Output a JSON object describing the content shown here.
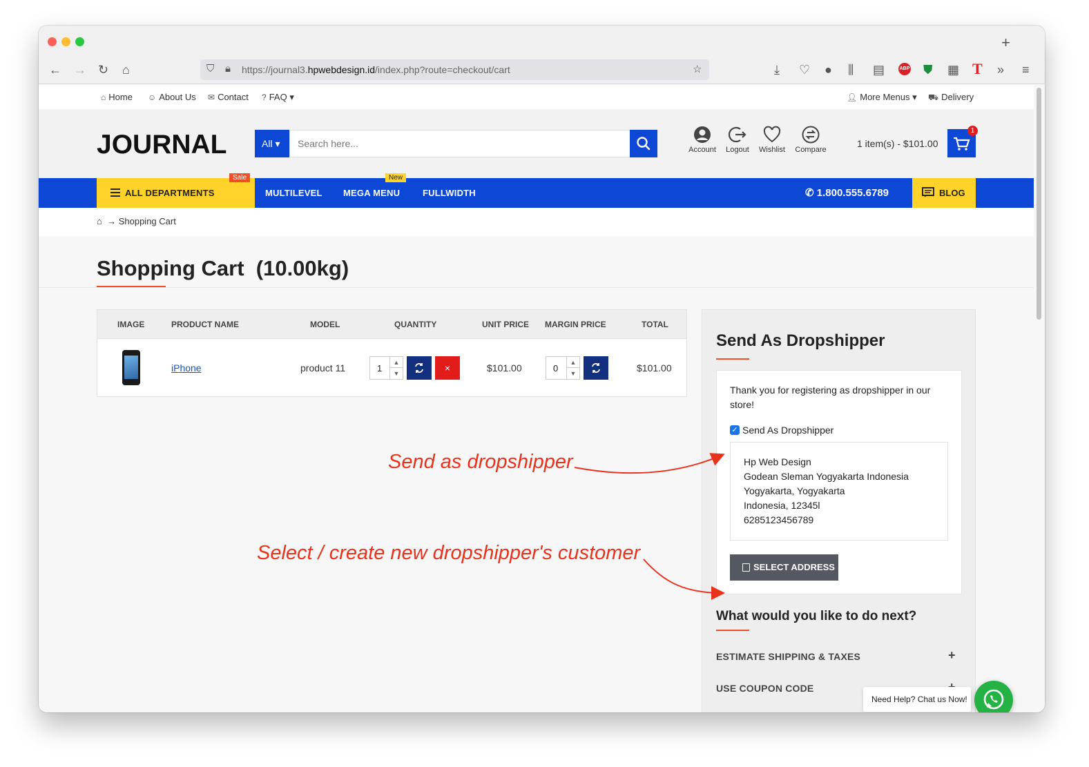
{
  "browser": {
    "url_prefix": "https://journal3.",
    "url_domain": "hpwebdesign.id",
    "url_path": "/index.php?route=checkout/cart",
    "abp_label": "ABP",
    "ext_t_label": "T"
  },
  "topbar": {
    "links": [
      "Home",
      "About Us",
      "Contact",
      "FAQ"
    ],
    "right_links": [
      "More Menus",
      "Delivery"
    ]
  },
  "header": {
    "logo": "JOURNAL",
    "search_category": "All",
    "search_placeholder": "Search here...",
    "icons": [
      "Account",
      "Logout",
      "Wishlist",
      "Compare"
    ],
    "cart_summary": "1 item(s) - $101.00",
    "cart_count": "1"
  },
  "nav": {
    "departments": "ALL DEPARTMENTS",
    "sale_badge": "Sale",
    "new_badge": "New",
    "links": [
      "MULTILEVEL",
      "MEGA MENU",
      "FULLWIDTH"
    ],
    "phone": "1.800.555.6789",
    "blog": "BLOG"
  },
  "breadcrumb": {
    "arrow": "→",
    "current": "Shopping Cart"
  },
  "page": {
    "title": "Shopping Cart  (10.00kg)"
  },
  "cart": {
    "columns": [
      "IMAGE",
      "PRODUCT NAME",
      "MODEL",
      "QUANTITY",
      "UNIT PRICE",
      "MARGIN PRICE",
      "TOTAL"
    ],
    "row": {
      "name": "iPhone",
      "model": "product 11",
      "quantity": "1",
      "unit_price": "$101.00",
      "margin": "0",
      "total": "$101.00"
    }
  },
  "sidebar": {
    "title": "Send As Dropshipper",
    "message": "Thank you for registering as dropshipper in our store!",
    "checkbox_label": "Send As Dropshipper",
    "address": [
      "Hp Web Design",
      "Godean Sleman Yogyakarta Indonesia",
      "Yogyakarta, Yogyakarta",
      "Indonesia, 12345l",
      "6285123456789"
    ],
    "select_button": "SELECT ADDRESS",
    "next_title": "What would you like to do next?",
    "accordions": [
      "ESTIMATE SHIPPING & TAXES",
      "USE COUPON CODE"
    ]
  },
  "whatsapp": {
    "tip": "Need Help? Chat us Now!"
  },
  "annotations": {
    "first": "Send as dropshipper",
    "second": "Select / create new dropshipper's customer"
  },
  "colors": {
    "brand_blue": "#0d47d6",
    "accent_yellow": "#ffd32a",
    "accent_orange": "#f04f26",
    "annotation_red": "#e8321c"
  }
}
